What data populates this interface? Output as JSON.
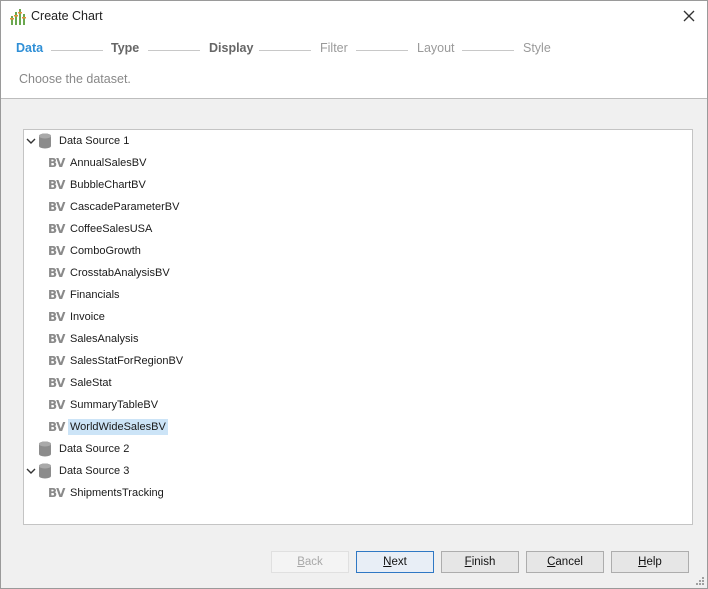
{
  "window": {
    "title": "Create Chart",
    "icon": "chart-icon"
  },
  "steps": [
    {
      "label": "Data",
      "state": "active"
    },
    {
      "label": "Type",
      "state": "done"
    },
    {
      "label": "Display",
      "state": "done"
    },
    {
      "label": "Filter",
      "state": "future"
    },
    {
      "label": "Layout",
      "state": "future"
    },
    {
      "label": "Style",
      "state": "future"
    }
  ],
  "subtitle": "Choose the dataset.",
  "tree": {
    "sources": [
      {
        "label": "Data Source 1",
        "expanded": true,
        "items": [
          "AnnualSalesBV",
          "BubbleChartBV",
          "CascadeParameterBV",
          "CoffeeSalesUSA",
          "ComboGrowth",
          "CrosstabAnalysisBV",
          "Financials",
          "Invoice",
          "SalesAnalysis",
          "SalesStatForRegionBV",
          "SaleStat",
          "SummaryTableBV",
          "WorldWideSalesBV"
        ]
      },
      {
        "label": "Data Source 2",
        "expanded": false,
        "items": []
      },
      {
        "label": "Data Source 3",
        "expanded": true,
        "items": [
          "ShipmentsTracking"
        ]
      }
    ],
    "selected": "WorldWideSalesBV",
    "item_icon": "BV"
  },
  "buttons": {
    "back": {
      "pre": "",
      "accel": "B",
      "post": "ack"
    },
    "next": {
      "pre": "",
      "accel": "N",
      "post": "ext"
    },
    "finish": {
      "pre": "",
      "accel": "F",
      "post": "inish"
    },
    "cancel": {
      "pre": "",
      "accel": "C",
      "post": "ancel"
    },
    "help": {
      "pre": "",
      "accel": "H",
      "post": "elp"
    }
  },
  "colors": {
    "accent": "#2f8fd6",
    "selection": "#cce4f7"
  }
}
